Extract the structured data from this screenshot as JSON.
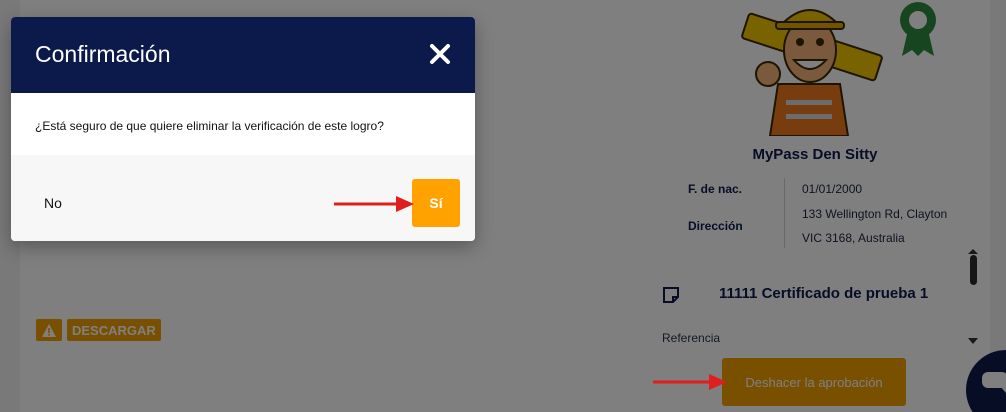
{
  "background": {
    "download_label": "DESCARGAR",
    "profile": {
      "name": "MyPass Den Sitty",
      "fields": [
        {
          "label": "F. de nac.",
          "value_lines": [
            "01/01/2000"
          ]
        },
        {
          "label": "Dirección",
          "value_lines": [
            "133 Wellington Rd, Clayton",
            "VIC 3168, Australia"
          ]
        }
      ]
    },
    "certificate": {
      "title": "11111 Certificado de prueba 1",
      "reference_label": "Referencia",
      "undo_label": "Deshacer la aprobación"
    }
  },
  "modal": {
    "title": "Confirmación",
    "message": "¿Está seguro de que quiere eliminar la verificación de este logro?",
    "no_label": "No",
    "yes_label": "Sí"
  },
  "colors": {
    "navy": "#0c1a4b",
    "accent_orange": "#ffa200",
    "annotation_red": "#e01e1e"
  },
  "icons": [
    "warning-icon",
    "award-ribbon-icon",
    "note-icon",
    "close-icon",
    "chat-icon"
  ]
}
